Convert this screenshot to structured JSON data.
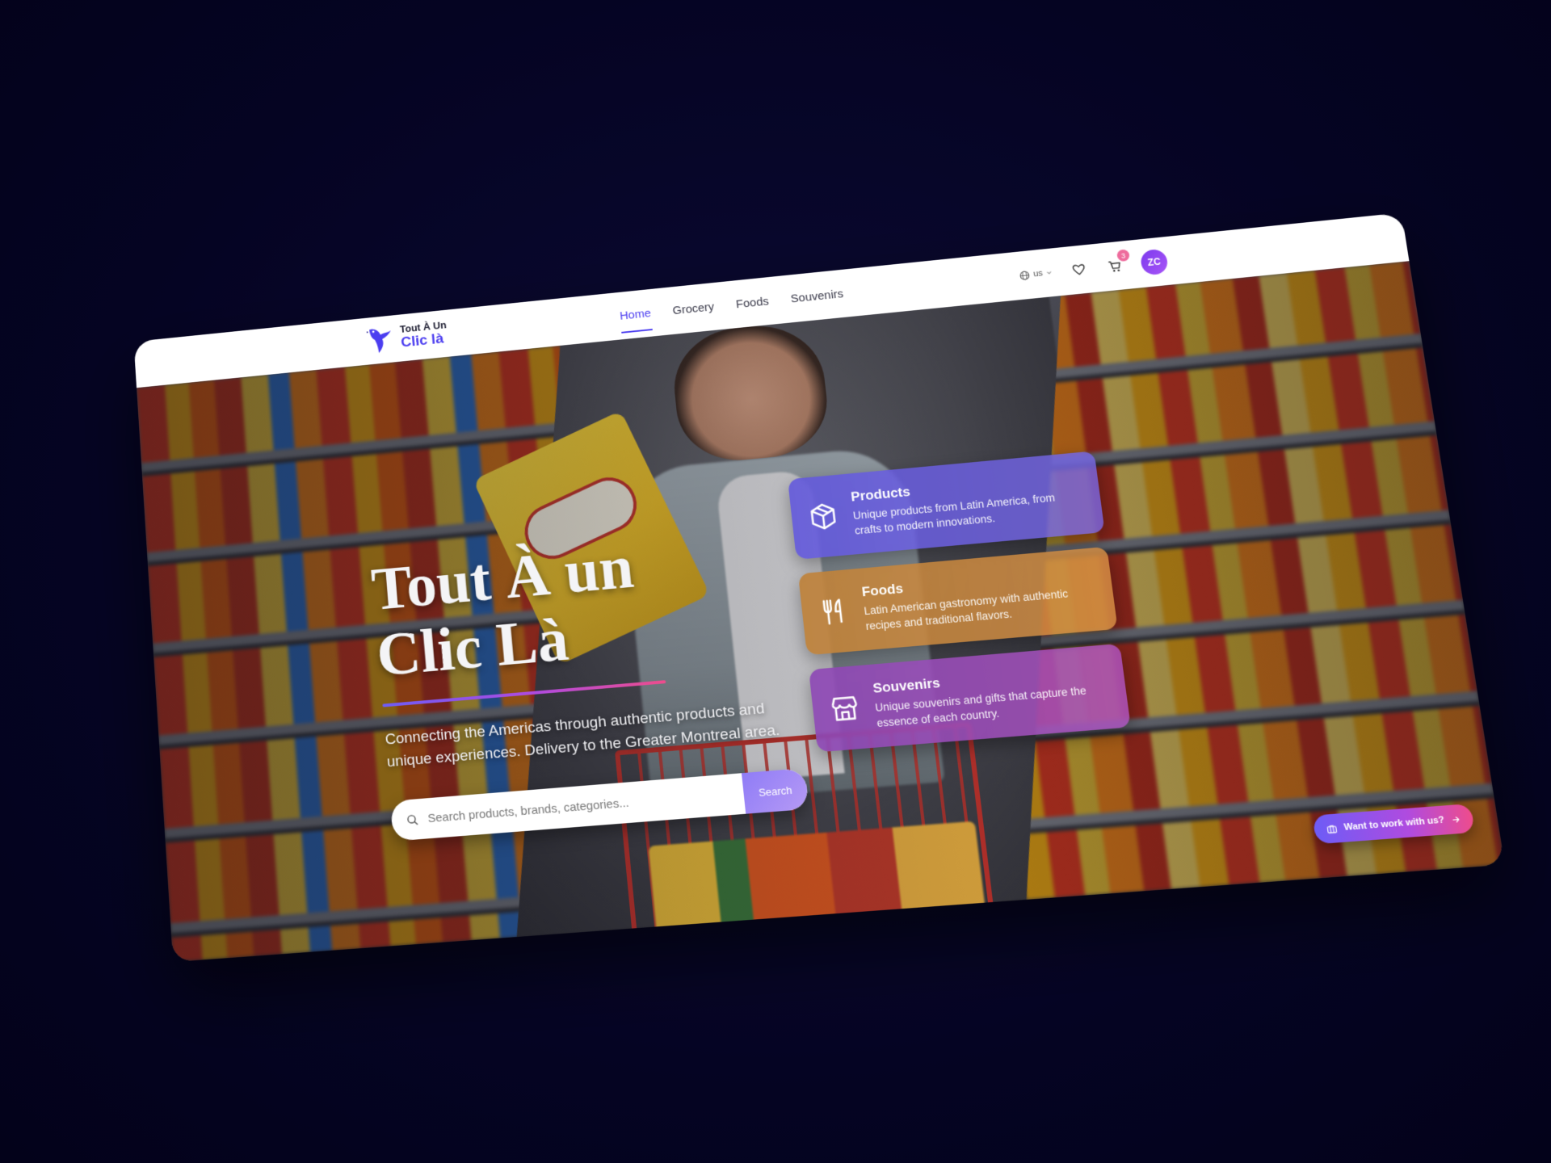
{
  "brand": {
    "line1": "Tout À Un",
    "line2": "Clic là",
    "accent_color": "#4b3df0"
  },
  "nav": {
    "items": [
      {
        "label": "Home",
        "active": true
      },
      {
        "label": "Grocery",
        "active": false
      },
      {
        "label": "Foods",
        "active": false
      },
      {
        "label": "Souvenirs",
        "active": false
      }
    ]
  },
  "header": {
    "language": "us",
    "cart_count": "3",
    "avatar_initials": "ZC",
    "icons": [
      "globe-icon",
      "heart-icon",
      "cart-icon"
    ]
  },
  "hero": {
    "title_line1": "Tout À un",
    "title_line2": "Clic Là",
    "subtitle": "Connecting the Americas through authentic products and unique experiences. Delivery to the Greater Montreal area.",
    "search_placeholder": "Search products, brands, categories...",
    "search_button": "Search"
  },
  "categories": [
    {
      "title": "Products",
      "description": "Unique products from Latin America, from crafts to modern innovations.",
      "icon": "box-icon",
      "color": "#6056dc"
    },
    {
      "title": "Foods",
      "description": "Latin American gastronomy with authentic recipes and traditional flavors.",
      "icon": "utensils-icon",
      "color": "#be8037"
    },
    {
      "title": "Souvenirs",
      "description": "Unique souvenirs and gifts that capture the essence of each country.",
      "icon": "store-icon",
      "color": "#8c46b4"
    }
  ],
  "cta": {
    "label": "Want to work with us?",
    "icon": "briefcase-icon"
  }
}
